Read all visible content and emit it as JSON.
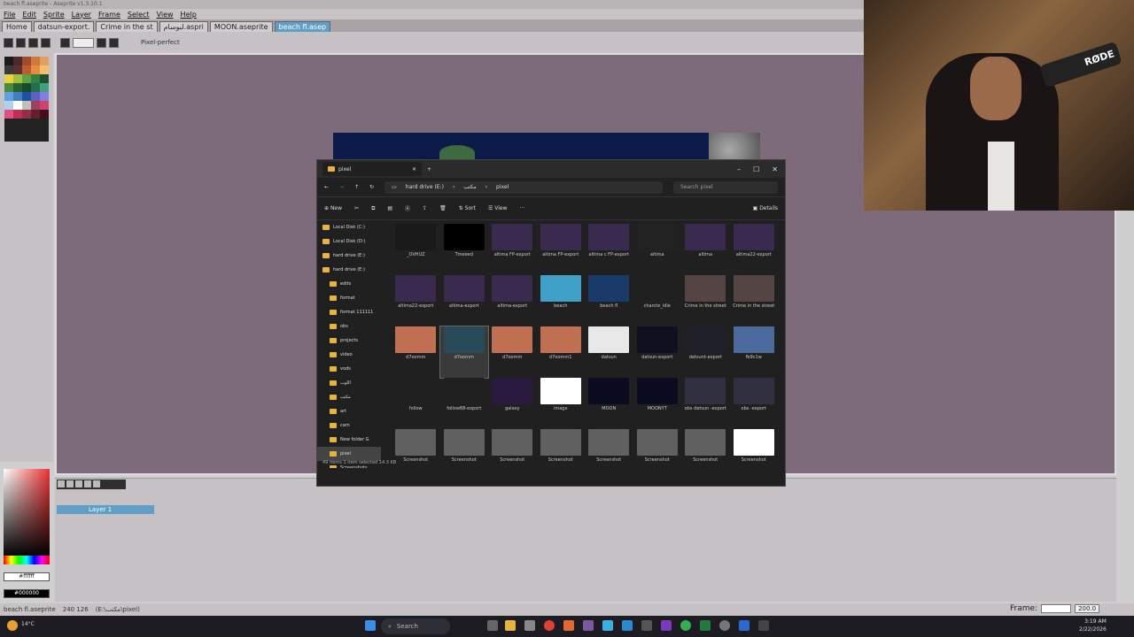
{
  "window_title": "beach fl.aseprite - Aseprite v1.3.10.1",
  "menu": [
    "File",
    "Edit",
    "Sprite",
    "Layer",
    "Frame",
    "Select",
    "View",
    "Help"
  ],
  "tabs": [
    {
      "label": "Home",
      "active": false
    },
    {
      "label": "datsun-export.",
      "active": false
    },
    {
      "label": "Crime in the st",
      "active": false
    },
    {
      "label": "لبوسام.aspri",
      "active": false
    },
    {
      "label": "MOON.aseprite",
      "active": false
    },
    {
      "label": "beach fl.asep",
      "active": true
    }
  ],
  "toolbar": {
    "pixel_perfect": "Pixel-perfect"
  },
  "palette_colors": [
    "#1b1b1b",
    "#4a2a2a",
    "#a04a2a",
    "#d07a3a",
    "#e0a060",
    "#3a3a3a",
    "#5a3030",
    "#c05a30",
    "#e88a40",
    "#f0c070",
    "#e8d040",
    "#a0c040",
    "#60a040",
    "#308040",
    "#205030",
    "#4a8a40",
    "#2a6030",
    "#1a4a2a",
    "#207050",
    "#40a080",
    "#60a0e0",
    "#4080c0",
    "#2050a0",
    "#6060c0",
    "#8080e0",
    "#b0d0f0",
    "#ffffff",
    "#c0c0c0",
    "#a04060",
    "#d04070",
    "#e05080",
    "#c03050",
    "#903040",
    "#602030",
    "#401020"
  ],
  "colors": {
    "fg": "#ffffff",
    "bg": "#000000",
    "fg_label": "#ffffff",
    "bg_label": "#000000"
  },
  "layer_name": "Layer 1",
  "status": {
    "file": "beach fl.aseprite",
    "coords": "240 126",
    "path": "(E:\\مكتب\\pixel)"
  },
  "frame": {
    "label": "Frame:",
    "zoom": "200.0"
  },
  "explorer": {
    "tab_title": "pixel",
    "breadcrumb": [
      "hard drive (E:)",
      "مكتب",
      "pixel"
    ],
    "search_placeholder": "Search pixel",
    "commands": {
      "new": "New",
      "sort": "Sort",
      "view": "View",
      "details": "Details"
    },
    "nav": [
      {
        "label": "Local Disk (C:)",
        "sel": false
      },
      {
        "label": "Local Disk (D:)",
        "sel": false
      },
      {
        "label": "hard drive (E:)",
        "sel": false
      },
      {
        "label": "hard drive (E:)",
        "sel": false
      },
      {
        "label": "edits",
        "sel": false
      },
      {
        "label": "format",
        "sel": false
      },
      {
        "label": "format 111111",
        "sel": false
      },
      {
        "label": "obs",
        "sel": false
      },
      {
        "label": "projects",
        "sel": false
      },
      {
        "label": "video",
        "sel": false
      },
      {
        "label": "vods",
        "sel": false
      },
      {
        "label": "اللوب",
        "sel": false
      },
      {
        "label": "مكتب",
        "sel": false
      },
      {
        "label": "art",
        "sel": false
      },
      {
        "label": "cam",
        "sel": false
      },
      {
        "label": "New folder G",
        "sel": false
      },
      {
        "label": "pixel",
        "sel": true
      },
      {
        "label": "Screenshots",
        "sel": false
      }
    ],
    "files": [
      {
        "name": "_OVHUZ",
        "color": "#1a1a1a",
        "sel": false
      },
      {
        "name": "Tmeeed",
        "color": "#000000",
        "sel": false
      },
      {
        "name": "altima FP-export",
        "color": "#3a2a50",
        "sel": false
      },
      {
        "name": "altima FP-export",
        "color": "#3a2a50",
        "sel": false
      },
      {
        "name": "altima c FP-export",
        "color": "#3a2a50",
        "sel": false
      },
      {
        "name": "altima",
        "color": "#222222",
        "sel": false
      },
      {
        "name": "altima",
        "color": "#3a2a50",
        "sel": false
      },
      {
        "name": "altima22-export",
        "color": "#3a2a50",
        "sel": false
      },
      {
        "name": "altima22-export",
        "color": "#3a2a50",
        "sel": false
      },
      {
        "name": "altima-export",
        "color": "#3a2a50",
        "sel": false
      },
      {
        "name": "altima-export",
        "color": "#3a2a50",
        "sel": false
      },
      {
        "name": "beach",
        "color": "#3fa0c8",
        "sel": false
      },
      {
        "name": "beach fl",
        "color": "#1a3a6a",
        "sel": false
      },
      {
        "name": "charcte_idle",
        "color": "#202020",
        "sel": false
      },
      {
        "name": "Crime in the street",
        "color": "#554444",
        "sel": false
      },
      {
        "name": "Crime in the street",
        "color": "#554444",
        "sel": false
      },
      {
        "name": "d7oomm",
        "color": "#c07050",
        "sel": false
      },
      {
        "name": "d7oomm",
        "color": "#2a4a5a",
        "sel": true
      },
      {
        "name": "d7oomm",
        "color": "#c07050",
        "sel": false
      },
      {
        "name": "d7oomm1",
        "color": "#c07050",
        "sel": false
      },
      {
        "name": "datsun",
        "color": "#e8e8e8",
        "sel": false
      },
      {
        "name": "datsun-export",
        "color": "#101020",
        "sel": false
      },
      {
        "name": "datsunt-export",
        "color": "#202028",
        "sel": false
      },
      {
        "name": "fb9c1w",
        "color": "#4a6aa0",
        "sel": false
      },
      {
        "name": "follow",
        "color": "#202020",
        "sel": false
      },
      {
        "name": "follow88-export",
        "color": "#202020",
        "sel": false
      },
      {
        "name": "galaxy",
        "color": "#2a1a40",
        "sel": false
      },
      {
        "name": "image",
        "color": "#ffffff",
        "sel": false
      },
      {
        "name": "MOON",
        "color": "#0a0a20",
        "sel": false
      },
      {
        "name": "MOONYT",
        "color": "#0a0a20",
        "sel": false
      },
      {
        "name": "obs datsun -export",
        "color": "#303040",
        "sel": false
      },
      {
        "name": "obs -export",
        "color": "#303040",
        "sel": false
      },
      {
        "name": "Screenshot",
        "color": "#606060",
        "sel": false
      },
      {
        "name": "Screenshot",
        "color": "#606060",
        "sel": false
      },
      {
        "name": "Screenshot",
        "color": "#606060",
        "sel": false
      },
      {
        "name": "Screenshot",
        "color": "#606060",
        "sel": false
      },
      {
        "name": "Screenshot",
        "color": "#606060",
        "sel": false
      },
      {
        "name": "Screenshot",
        "color": "#606060",
        "sel": false
      },
      {
        "name": "Screenshot",
        "color": "#606060",
        "sel": false
      },
      {
        "name": "Screenshot",
        "color": "#ffffff",
        "sel": false
      }
    ],
    "status": "49 items   1 item selected 14.3 KB"
  },
  "taskbar": {
    "search": "Search",
    "time": "3:19 AM",
    "date": "2/22/2026",
    "weather": "14°C"
  },
  "webcam": {
    "mic_brand": "RØDE"
  }
}
